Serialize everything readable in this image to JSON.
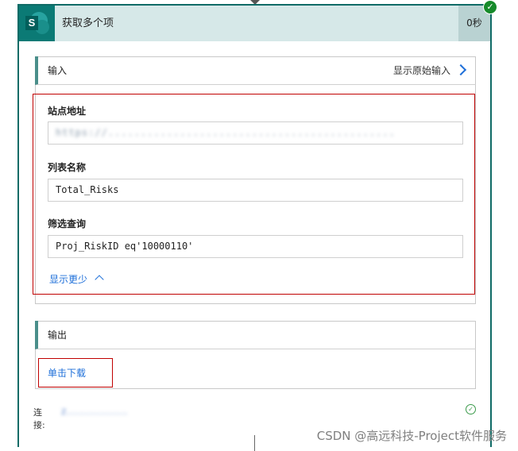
{
  "action": {
    "title": "获取多个项",
    "duration": "0秒",
    "icon": "sharepoint-icon",
    "status_icon": "success-check-icon"
  },
  "input": {
    "header": "输入",
    "raw_link": "显示原始输入",
    "fields": [
      {
        "label": "站点地址",
        "value": "https://............................................",
        "blurred": true
      },
      {
        "label": "列表名称",
        "value": "Total_Risks"
      },
      {
        "label": "筛选查询",
        "value": "Proj_RiskID eq'10000110'"
      }
    ],
    "show_less": "显示更少"
  },
  "output": {
    "header": "输出",
    "download": "单击下载"
  },
  "connection": {
    "label": "连接:",
    "value": "z................",
    "status_icon": "connection-ok-icon"
  },
  "watermark": "CSDN @高远科技-Project软件服务",
  "colors": {
    "accent": "#0b7a75",
    "link": "#1e6fd9",
    "highlight_frame": "#c00000"
  }
}
